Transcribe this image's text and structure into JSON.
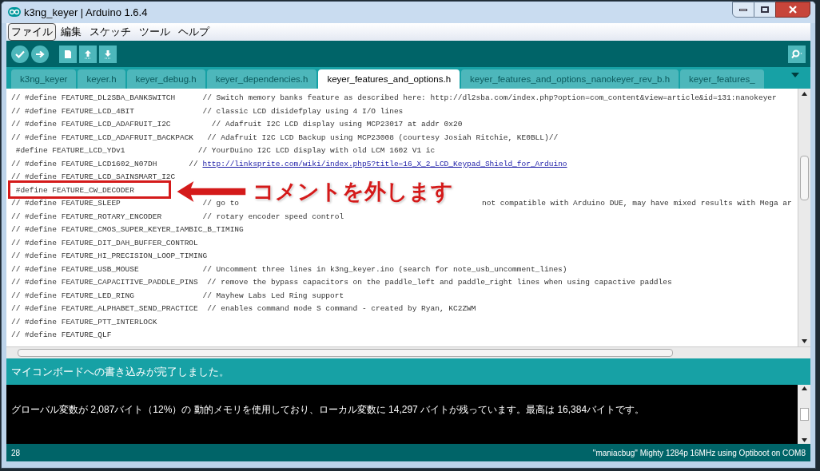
{
  "window": {
    "title": "k3ng_keyer | Arduino 1.6.4"
  },
  "menu": [
    {
      "label": "ファイル",
      "selected": true
    },
    {
      "label": "編集",
      "selected": false
    },
    {
      "label": "スケッチ",
      "selected": false
    },
    {
      "label": "ツール",
      "selected": false
    },
    {
      "label": "ヘルプ",
      "selected": false
    }
  ],
  "tabs": [
    {
      "label": "k3ng_keyer",
      "selected": false
    },
    {
      "label": "keyer.h",
      "selected": false
    },
    {
      "label": "keyer_debug.h",
      "selected": false
    },
    {
      "label": "keyer_dependencies.h",
      "selected": false
    },
    {
      "label": "keyer_features_and_options.h",
      "selected": true
    },
    {
      "label": "keyer_features_and_options_nanokeyer_rev_b.h",
      "selected": false
    },
    {
      "label": "keyer_features_",
      "selected": false
    }
  ],
  "editor": {
    "lines": [
      [
        {
          "kind": "code",
          "text": "// #define FEATURE_DL2SBA_BANKSWITCH      // Switch memory banks feature as described here: http://dl2sba.com/index.php?option=com_content&view=article&id=131:nanokeyer"
        }
      ],
      [
        {
          "kind": "code",
          "text": "// #define FEATURE_LCD_4BIT               // classic LCD disidefplay using 4 I/O lines"
        }
      ],
      [
        {
          "kind": "code",
          "text": "// #define FEATURE_LCD_ADAFRUIT_I2C         // Adafruit I2C LCD display using MCP23017 at addr 0x20"
        }
      ],
      [
        {
          "kind": "code",
          "text": "// #define FEATURE_LCD_ADAFRUIT_BACKPACK   // Adafruit I2C LCD Backup using MCP23008 (courtesy Josiah Ritchie, KE0BLL)//"
        }
      ],
      [
        {
          "kind": "code",
          "text": " #define FEATURE_LCD_YDv1                // YourDuino I2C LCD display with old LCM 1602 V1 ic"
        }
      ],
      [
        {
          "kind": "code",
          "text": "// #define FEATURE_LCD1602_N07DH       // "
        },
        {
          "kind": "link",
          "text": "http://linksprite.com/wiki/index.php5?title=16_X_2_LCD_Keypad_Shield_for_Arduino"
        }
      ],
      [
        {
          "kind": "code",
          "text": "// #define FEATURE_LCD_SAINSMART_I2C"
        }
      ],
      [
        {
          "kind": "code",
          "text": " #define FEATURE_CW_DECODER"
        }
      ],
      [
        {
          "kind": "code",
          "text": "// #define FEATURE_SLEEP                  // go to"
        },
        {
          "kind": "tail",
          "text": "not compatible with Arduino DUE, may have mixed results with Mega ar"
        }
      ],
      [
        {
          "kind": "code",
          "text": "// #define FEATURE_ROTARY_ENCODER         // rotary encoder speed control"
        }
      ],
      [
        {
          "kind": "code",
          "text": "// #define FEATURE_CMOS_SUPER_KEYER_IAMBIC_B_TIMING"
        }
      ],
      [
        {
          "kind": "code",
          "text": "// #define FEATURE_DIT_DAH_BUFFER_CONTROL"
        }
      ],
      [
        {
          "kind": "code",
          "text": "// #define FEATURE_HI_PRECISION_LOOP_TIMING"
        }
      ],
      [
        {
          "kind": "code",
          "text": "// #define FEATURE_USB_MOUSE              // Uncomment three lines in k3ng_keyer.ino (search for note_usb_uncomment_lines)"
        }
      ],
      [
        {
          "kind": "code",
          "text": "// #define FEATURE_CAPACITIVE_PADDLE_PINS  // remove the bypass capacitors on the paddle_left and paddle_right lines when using capactive paddles"
        }
      ],
      [
        {
          "kind": "code",
          "text": "// #define FEATURE_LED_RING               // Mayhew Labs Led Ring support"
        }
      ],
      [
        {
          "kind": "code",
          "text": "// #define FEATURE_ALPHABET_SEND_PRACTICE  // enables command mode S command - created by Ryan, KC2ZWM"
        }
      ],
      [
        {
          "kind": "code",
          "text": "// #define FEATURE_PTT_INTERLOCK"
        }
      ],
      [
        {
          "kind": "code",
          "text": "// #define FEATURE_QLF"
        }
      ]
    ]
  },
  "annotation": {
    "text": "コメントを外します"
  },
  "status": "マイコンボードへの書き込みが完了しました。",
  "console": [
    "グローバル変数が 2,087バイト（12%）の 動的メモリを使用しており、ローカル変数に 14,297 バイトが残っています。最高は 16,384バイトです。"
  ],
  "footer": {
    "line": "28",
    "board": "\"maniacbug\" Mighty 1284p 16MHz using Optiboot on COM8"
  }
}
